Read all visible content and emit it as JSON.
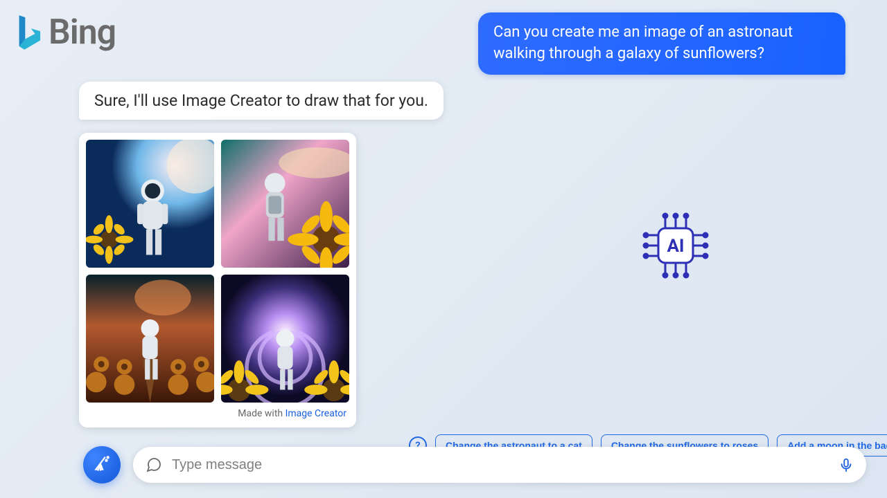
{
  "brand": {
    "name": "Bing"
  },
  "conversation": {
    "user_prompt": "Can you create me an image of an astronaut walking through a galaxy of sunflowers?",
    "assistant_reply": "Sure, I'll use Image Creator to draw that for you."
  },
  "image_card": {
    "made_with_prefix": "Made with ",
    "made_with_link": "Image Creator"
  },
  "suggestions": [
    "Change the astronaut to a cat",
    "Change the sunflowers to roses",
    "Add a moon in the background"
  ],
  "composer": {
    "placeholder": "Type message"
  },
  "ai_badge": {
    "label": "AI"
  },
  "icons": {
    "help": "?",
    "chat": "chat-bubble-icon",
    "mic": "microphone-icon",
    "broom": "broom-icon",
    "logo": "bing-logo-icon",
    "chip": "ai-chip-icon"
  }
}
